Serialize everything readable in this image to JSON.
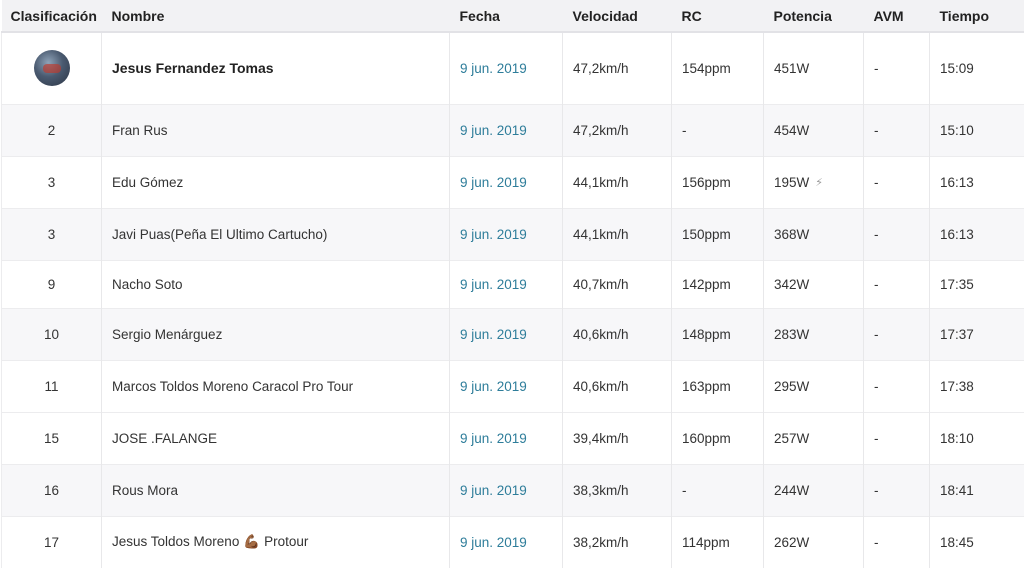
{
  "columns": {
    "rank": "Clasificación",
    "name": "Nombre",
    "date": "Fecha",
    "speed": "Velocidad",
    "hr": "RC",
    "power": "Potencia",
    "avm": "AVM",
    "time": "Tiempo"
  },
  "rows": [
    {
      "rank": "",
      "avatar": "avatar-photo",
      "name": "Jesus Fernandez Tomas",
      "date": "9 jun. 2019",
      "speed": "47,2km/h",
      "hr": "154ppm",
      "power": "451W",
      "avm": "-",
      "time": "15:09"
    },
    {
      "rank": "2",
      "name": "Fran Rus",
      "date": "9 jun. 2019",
      "speed": "47,2km/h",
      "hr": "-",
      "power": "454W",
      "avm": "-",
      "time": "15:10"
    },
    {
      "rank": "3",
      "name": "Edu Gómez",
      "date": "9 jun. 2019",
      "speed": "44,1km/h",
      "hr": "156ppm",
      "power": "195W",
      "power_icon": "lightning-bolt-icon",
      "avm": "-",
      "time": "16:13"
    },
    {
      "rank": "3",
      "name": "Javi Puas(Peña El Ultimo Cartucho)",
      "date": "9 jun. 2019",
      "speed": "44,1km/h",
      "hr": "150ppm",
      "power": "368W",
      "avm": "-",
      "time": "16:13"
    },
    {
      "rank": "9",
      "name": "Nacho Soto",
      "date": "9 jun. 2019",
      "speed": "40,7km/h",
      "hr": "142ppm",
      "power": "342W",
      "avm": "-",
      "time": "17:35"
    },
    {
      "rank": "10",
      "name": "Sergio Menárguez",
      "date": "9 jun. 2019",
      "speed": "40,6km/h",
      "hr": "148ppm",
      "power": "283W",
      "avm": "-",
      "time": "17:37"
    },
    {
      "rank": "11",
      "name": "Marcos Toldos Moreno Caracol Pro Tour",
      "date": "9 jun. 2019",
      "speed": "40,6km/h",
      "hr": "163ppm",
      "power": "295W",
      "avm": "-",
      "time": "17:38"
    },
    {
      "rank": "15",
      "name": "JOSE .FALANGE",
      "date": "9 jun. 2019",
      "speed": "39,4km/h",
      "hr": "160ppm",
      "power": "257W",
      "avm": "-",
      "time": "18:10"
    },
    {
      "rank": "16",
      "name": "Rous Mora",
      "date": "9 jun. 2019",
      "speed": "38,3km/h",
      "hr": "-",
      "power": "244W",
      "avm": "-",
      "time": "18:41"
    },
    {
      "rank": "17",
      "name": "Jesus Toldos Moreno",
      "name_emoji": "💪🏾",
      "name_suffix": "Protour",
      "date": "9 jun. 2019",
      "speed": "38,2km/h",
      "hr": "114ppm",
      "power": "262W",
      "avm": "-",
      "time": "18:45"
    }
  ]
}
